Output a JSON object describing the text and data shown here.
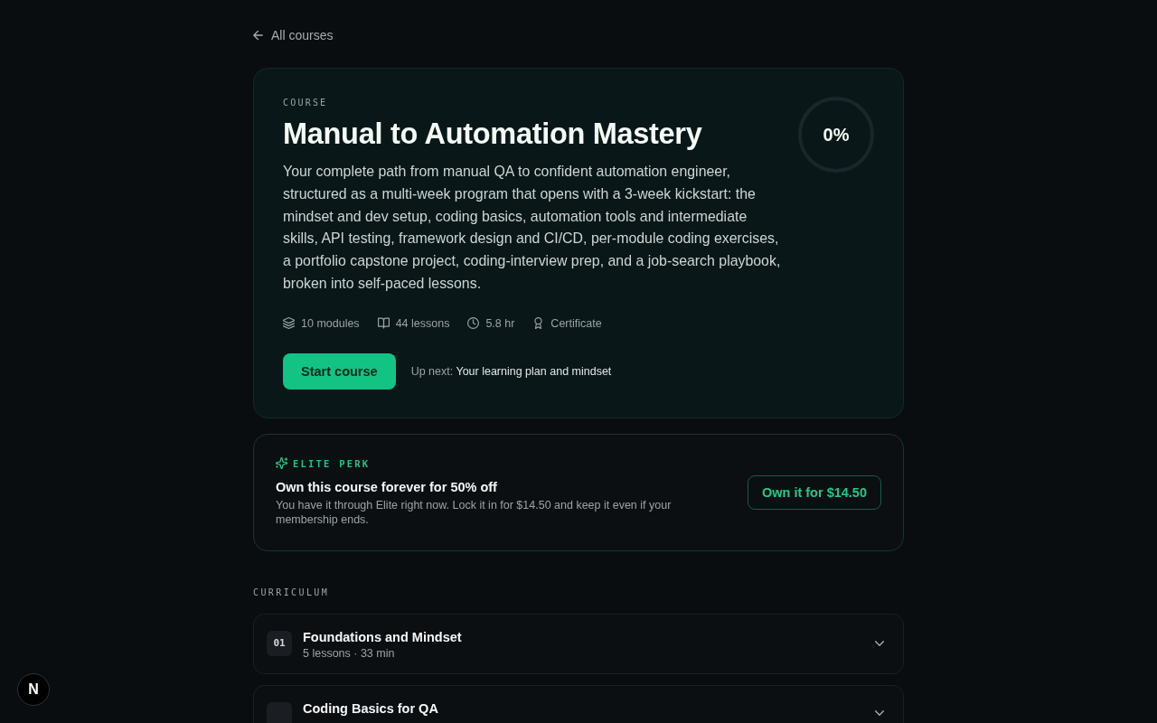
{
  "back_link": {
    "label": "All courses"
  },
  "course": {
    "eyebrow": "COURSE",
    "title": "Manual to Automation Mastery",
    "description": "Your complete path from manual QA to confident automation engineer, structured as a multi-week program that opens with a 3-week kickstart: the mindset and dev setup, coding basics, automation tools and intermediate skills, API testing, framework design and CI/CD, per-module coding exercises, a portfolio capstone project, coding-interview prep, and a job-search playbook, broken into self-paced lessons.",
    "progress": {
      "level": 0,
      "label": "0%"
    },
    "stats": [
      {
        "kind": "modules",
        "label": "10 modules"
      },
      {
        "kind": "lessons",
        "label": "44 lessons"
      },
      {
        "kind": "duration",
        "label": "5.8 hr"
      },
      {
        "kind": "certificate",
        "label": "Certificate"
      }
    ],
    "start_button": "Start course",
    "up_next": {
      "label": "Up next:",
      "value": "Your learning plan and mindset"
    }
  },
  "perk": {
    "eyebrow": "ELITE PERK",
    "title": "Own this course forever for 50% off",
    "description": "You have it through Elite right now. Lock it in for $14.50 and keep it even if your membership ends.",
    "button": "Own it for $14.50"
  },
  "curriculum": {
    "heading": "CURRICULUM",
    "modules": [
      {
        "number": "01",
        "title": "Foundations and Mindset",
        "meta": "5 lessons · 33 min",
        "expanded": false
      },
      {
        "title": "Coding Basics for QA",
        "expanded": false
      }
    ]
  },
  "dev_badge": {
    "label": "N"
  }
}
